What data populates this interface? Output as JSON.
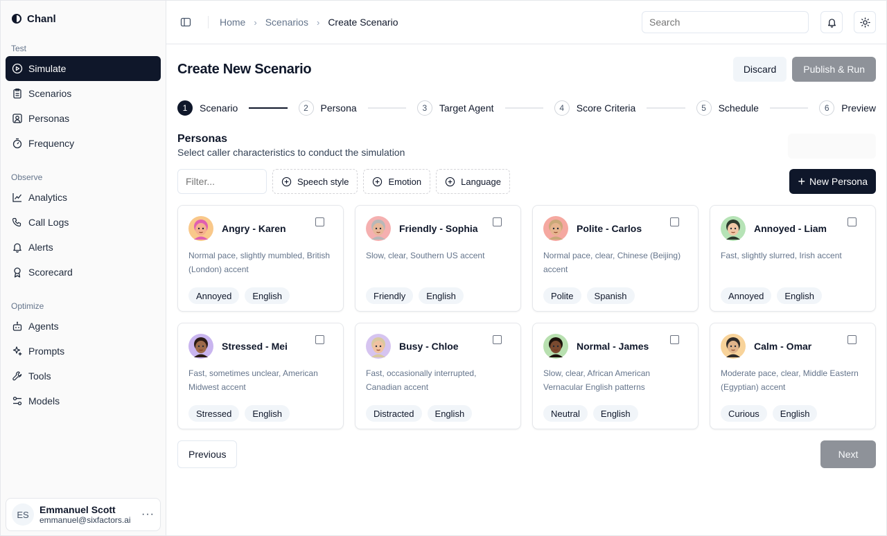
{
  "brand": {
    "name": "Chanl"
  },
  "sidebar": {
    "sections": [
      {
        "title": "Test",
        "items": [
          {
            "label": "Simulate",
            "icon": "play-circle-icon",
            "active": true
          },
          {
            "label": "Scenarios",
            "icon": "clipboard-icon"
          },
          {
            "label": "Personas",
            "icon": "user-square-icon"
          },
          {
            "label": "Frequency",
            "icon": "timer-icon"
          }
        ]
      },
      {
        "title": "Observe",
        "items": [
          {
            "label": "Analytics",
            "icon": "line-chart-icon"
          },
          {
            "label": "Call Logs",
            "icon": "phone-icon"
          },
          {
            "label": "Alerts",
            "icon": "bell-icon"
          },
          {
            "label": "Scorecard",
            "icon": "award-icon"
          }
        ]
      },
      {
        "title": "Optimize",
        "items": [
          {
            "label": "Agents",
            "icon": "bot-icon"
          },
          {
            "label": "Prompts",
            "icon": "sparkles-icon"
          },
          {
            "label": "Tools",
            "icon": "wrench-icon"
          },
          {
            "label": "Models",
            "icon": "sliders-icon"
          }
        ]
      }
    ],
    "user": {
      "initials": "ES",
      "name": "Emmanuel Scott",
      "email": "emmanuel@sixfactors.ai"
    }
  },
  "topbar": {
    "breadcrumbs": [
      "Home",
      "Scenarios",
      "Create Scenario"
    ],
    "search_placeholder": "Search"
  },
  "page": {
    "title": "Create New Scenario",
    "discard_label": "Discard",
    "publish_label": "Publish & Run"
  },
  "steps": [
    {
      "num": "1",
      "label": "Scenario",
      "active": true
    },
    {
      "num": "2",
      "label": "Persona"
    },
    {
      "num": "3",
      "label": "Target Agent"
    },
    {
      "num": "4",
      "label": "Score Criteria"
    },
    {
      "num": "5",
      "label": "Schedule"
    },
    {
      "num": "6",
      "label": "Preview"
    }
  ],
  "personas_section": {
    "title": "Personas",
    "subtitle": "Select caller characteristics to conduct the simulation",
    "filter_placeholder": "Filter...",
    "filter_chips": [
      "Speech style",
      "Emotion",
      "Language"
    ],
    "new_button": "New Persona"
  },
  "personas": [
    {
      "name": "Angry - Karen",
      "desc": "Normal pace, slightly mumbled, British (London) accent",
      "tags": [
        "Annoyed",
        "English"
      ],
      "color": "#f9c88a",
      "skin": "#f5b08e",
      "hair": "#e05fb0"
    },
    {
      "name": "Friendly - Sophia",
      "desc": "Slow, clear, Southern US accent",
      "tags": [
        "Friendly",
        "English"
      ],
      "color": "#f5b0b0",
      "skin": "#e8b89a",
      "hair": "#b8b8b8"
    },
    {
      "name": "Polite - Carlos",
      "desc": "Normal pace, clear, Chinese (Beijing) accent",
      "tags": [
        "Polite",
        "Spanish"
      ],
      "color": "#f5a8a0",
      "skin": "#e6b48e",
      "hair": "#c9a878"
    },
    {
      "name": "Annoyed - Liam",
      "desc": "Fast, slightly slurred, Irish accent",
      "tags": [
        "Annoyed",
        "English"
      ],
      "color": "#b6e3b6",
      "skin": "#f0c7a6",
      "hair": "#2d3b2d"
    },
    {
      "name": "Stressed - Mei",
      "desc": "Fast, sometimes unclear, American Midwest accent",
      "tags": [
        "Stressed",
        "English"
      ],
      "color": "#c9b5ef",
      "skin": "#9c6a4a",
      "hair": "#2a1b14"
    },
    {
      "name": "Busy - Chloe",
      "desc": "Fast, occasionally interrupted, Canadian accent",
      "tags": [
        "Distracted",
        "English"
      ],
      "color": "#d6c4f0",
      "skin": "#f0c2a2",
      "hair": "#d9c9a0"
    },
    {
      "name": "Normal - James",
      "desc": "Slow, clear, African American Vernacular English patterns",
      "tags": [
        "Neutral",
        "English"
      ],
      "color": "#b8e0b0",
      "skin": "#7a4a30",
      "hair": "#1c120c"
    },
    {
      "name": "Calm - Omar",
      "desc": "Moderate pace, clear, Middle Eastern (Egyptian) accent",
      "tags": [
        "Curious",
        "English"
      ],
      "color": "#f8d39a",
      "skin": "#e0b48a",
      "hair": "#2e2a28"
    }
  ],
  "footer": {
    "previous": "Previous",
    "next": "Next"
  }
}
